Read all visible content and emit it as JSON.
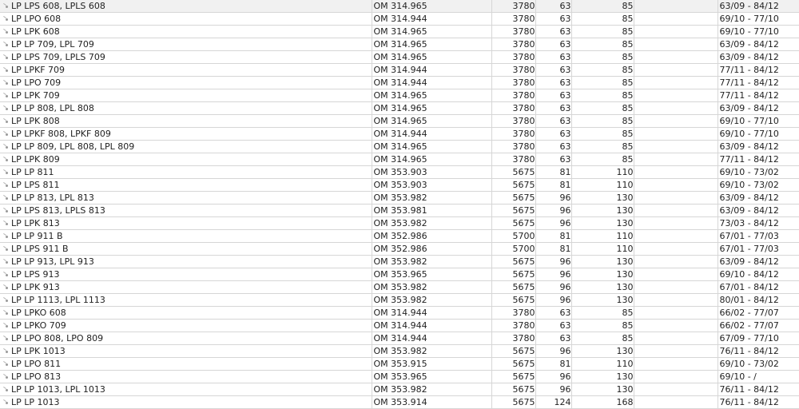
{
  "rows": [
    {
      "name": "LP LPS 608, LPLS 608",
      "engine": "OM 314.965",
      "ccm": "3780",
      "kw": "63",
      "hp": "85",
      "years": "63/09 - 84/12"
    },
    {
      "name": "LP LPO 608",
      "engine": "OM 314.944",
      "ccm": "3780",
      "kw": "63",
      "hp": "85",
      "years": "69/10 - 77/10"
    },
    {
      "name": "LP LPK 608",
      "engine": "OM 314.965",
      "ccm": "3780",
      "kw": "63",
      "hp": "85",
      "years": "69/10 - 77/10"
    },
    {
      "name": "LP LP 709, LPL 709",
      "engine": "OM 314.965",
      "ccm": "3780",
      "kw": "63",
      "hp": "85",
      "years": "63/09 - 84/12"
    },
    {
      "name": "LP LPS 709, LPLS 709",
      "engine": "OM 314.965",
      "ccm": "3780",
      "kw": "63",
      "hp": "85",
      "years": "63/09 - 84/12"
    },
    {
      "name": "LP LPKF 709",
      "engine": "OM 314.944",
      "ccm": "3780",
      "kw": "63",
      "hp": "85",
      "years": "77/11 - 84/12"
    },
    {
      "name": "LP LPO 709",
      "engine": "OM 314.944",
      "ccm": "3780",
      "kw": "63",
      "hp": "85",
      "years": "77/11 - 84/12"
    },
    {
      "name": "LP LPK 709",
      "engine": "OM 314.965",
      "ccm": "3780",
      "kw": "63",
      "hp": "85",
      "years": "77/11 - 84/12"
    },
    {
      "name": "LP LP 808, LPL 808",
      "engine": "OM 314.965",
      "ccm": "3780",
      "kw": "63",
      "hp": "85",
      "years": "63/09 - 84/12"
    },
    {
      "name": "LP LPK 808",
      "engine": "OM 314.965",
      "ccm": "3780",
      "kw": "63",
      "hp": "85",
      "years": "69/10 - 77/10"
    },
    {
      "name": "LP LPKF 808, LPKF 809",
      "engine": "OM 314.944",
      "ccm": "3780",
      "kw": "63",
      "hp": "85",
      "years": "69/10 - 77/10"
    },
    {
      "name": "LP LP 809, LPL 808, LPL 809",
      "engine": "OM 314.965",
      "ccm": "3780",
      "kw": "63",
      "hp": "85",
      "years": "63/09 - 84/12"
    },
    {
      "name": "LP LPK 809",
      "engine": "OM 314.965",
      "ccm": "3780",
      "kw": "63",
      "hp": "85",
      "years": "77/11 - 84/12"
    },
    {
      "name": "LP LP 811",
      "engine": "OM 353.903",
      "ccm": "5675",
      "kw": "81",
      "hp": "110",
      "years": "69/10 - 73/02"
    },
    {
      "name": "LP LPS 811",
      "engine": "OM 353.903",
      "ccm": "5675",
      "kw": "81",
      "hp": "110",
      "years": "69/10 - 73/02"
    },
    {
      "name": "LP LP 813, LPL 813",
      "engine": "OM 353.982",
      "ccm": "5675",
      "kw": "96",
      "hp": "130",
      "years": "63/09 - 84/12"
    },
    {
      "name": "LP LPS 813, LPLS 813",
      "engine": "OM 353.981",
      "ccm": "5675",
      "kw": "96",
      "hp": "130",
      "years": "63/09 - 84/12"
    },
    {
      "name": "LP LPK 813",
      "engine": "OM 353.982",
      "ccm": "5675",
      "kw": "96",
      "hp": "130",
      "years": "73/03 - 84/12"
    },
    {
      "name": "LP LP 911 B",
      "engine": "OM 352.986",
      "ccm": "5700",
      "kw": "81",
      "hp": "110",
      "years": "67/01 - 77/03"
    },
    {
      "name": "LP LPS 911 B",
      "engine": "OM 352.986",
      "ccm": "5700",
      "kw": "81",
      "hp": "110",
      "years": "67/01 - 77/03"
    },
    {
      "name": "LP LP 913, LPL 913",
      "engine": "OM 353.982",
      "ccm": "5675",
      "kw": "96",
      "hp": "130",
      "years": "63/09 - 84/12"
    },
    {
      "name": "LP LPS 913",
      "engine": "OM 353.965",
      "ccm": "5675",
      "kw": "96",
      "hp": "130",
      "years": "69/10 - 84/12"
    },
    {
      "name": "LP LPK 913",
      "engine": "OM 353.982",
      "ccm": "5675",
      "kw": "96",
      "hp": "130",
      "years": "67/01 - 84/12"
    },
    {
      "name": "LP LP 1113, LPL 1113",
      "engine": "OM 353.982",
      "ccm": "5675",
      "kw": "96",
      "hp": "130",
      "years": "80/01 - 84/12"
    },
    {
      "name": "LP LPKO 608",
      "engine": "OM 314.944",
      "ccm": "3780",
      "kw": "63",
      "hp": "85",
      "years": "66/02 - 77/07"
    },
    {
      "name": "LP LPKO 709",
      "engine": "OM 314.944",
      "ccm": "3780",
      "kw": "63",
      "hp": "85",
      "years": "66/02 - 77/07"
    },
    {
      "name": "LP LPO 808, LPO 809",
      "engine": "OM 314.944",
      "ccm": "3780",
      "kw": "63",
      "hp": "85",
      "years": "67/09 - 77/10"
    },
    {
      "name": "LP LPK 1013",
      "engine": "OM 353.982",
      "ccm": "5675",
      "kw": "96",
      "hp": "130",
      "years": "76/11 - 84/12"
    },
    {
      "name": "LP LPO 811",
      "engine": "OM 353.915",
      "ccm": "5675",
      "kw": "81",
      "hp": "110",
      "years": "69/10 - 73/02"
    },
    {
      "name": "LP LPO 813",
      "engine": "OM 353.965",
      "ccm": "5675",
      "kw": "96",
      "hp": "130",
      "years": "69/10 - /"
    },
    {
      "name": "LP LP 1013, LPL 1013",
      "engine": "OM 353.982",
      "ccm": "5675",
      "kw": "96",
      "hp": "130",
      "years": "76/11 - 84/12"
    },
    {
      "name": "LP LP 1013",
      "engine": "OM 353.914",
      "ccm": "5675",
      "kw": "124",
      "hp": "168",
      "years": "76/11 - 84/12"
    }
  ]
}
